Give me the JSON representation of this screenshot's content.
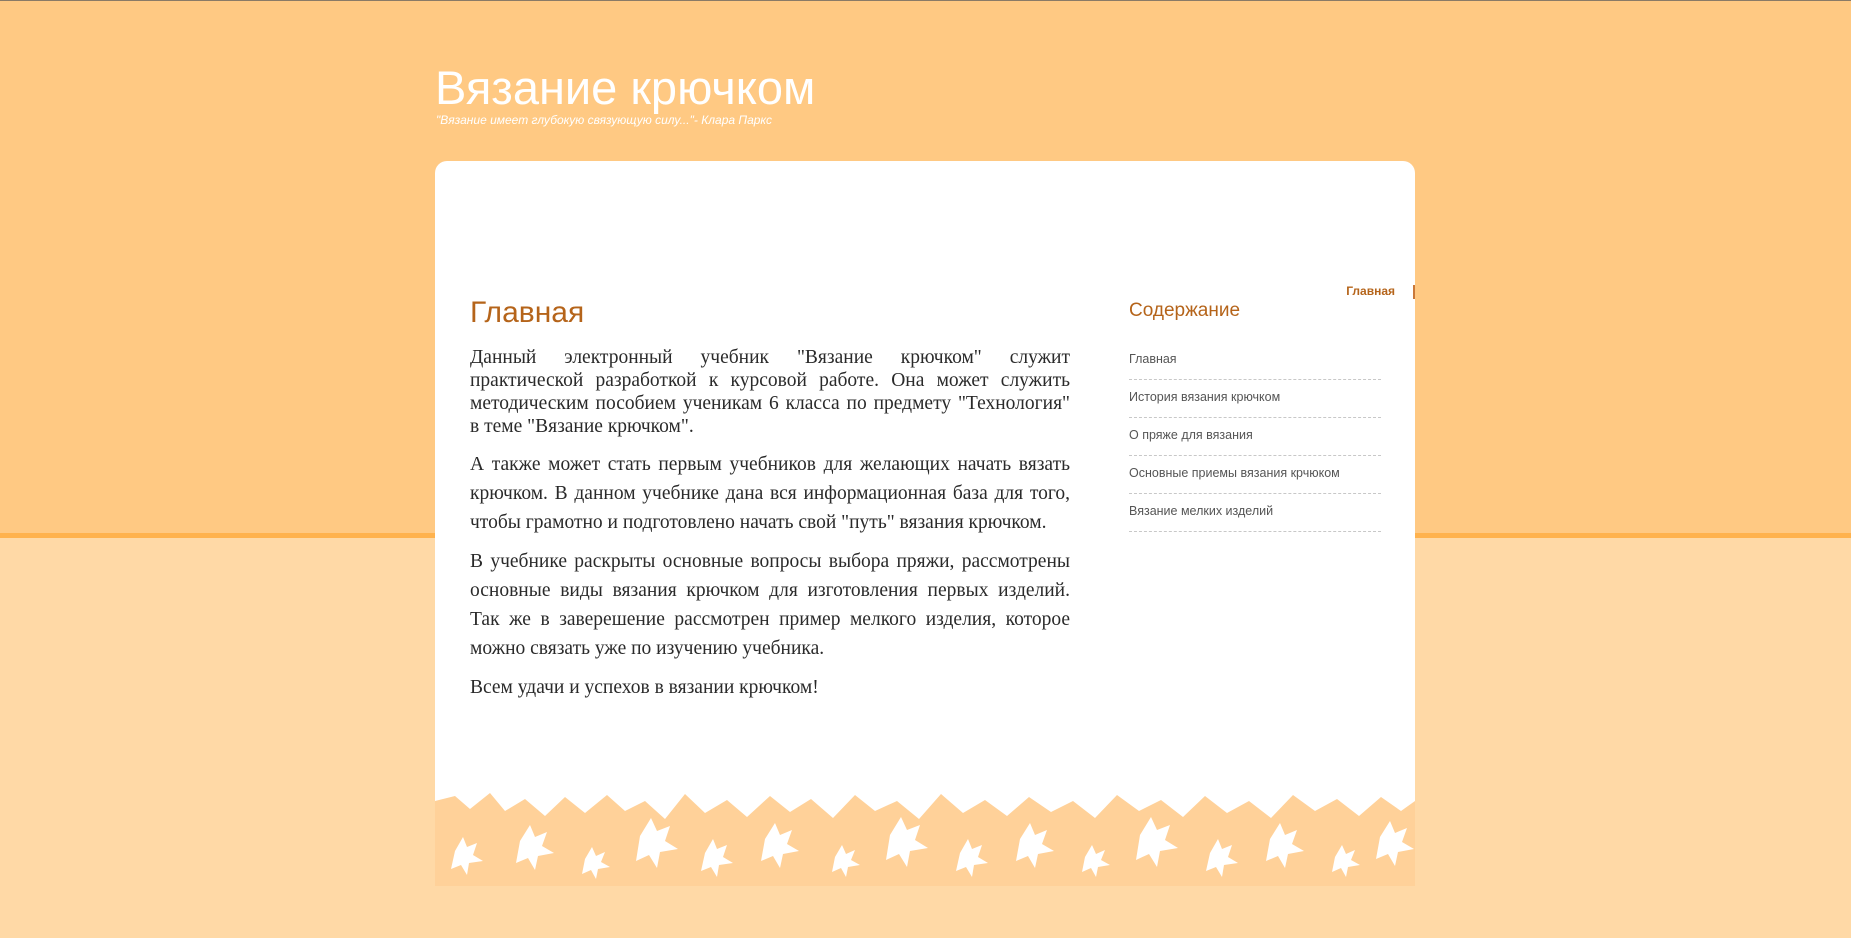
{
  "header": {
    "title": "Вязание крючком",
    "tagline": "\"Вязание имеет глубокую связующую силу...\"- Клара Паркс"
  },
  "top_nav": {
    "active_label": "Главная"
  },
  "main": {
    "title": "Главная",
    "paragraphs": [
      "Данный электронный учебник \"Вязание крючком\" служит практической разработкой к курсовой работе. Она может служить методическим пособием ученикам 6 класса по предмету \"Технология\" в теме \"Вязание крючком\".",
      "А также может стать первым учебников для желающих начать вязать крючком. В данном учебнике дана вся информационная база для того, чтобы грамотно и подготовлено начать свой \"путь\" вязания крючком.",
      "В учебнике раскрыты основные вопросы выбора пряжи, рассмотрены основные виды вязания крючком для изготовления первых изделий. Так  же в заверешение рассмотрен пример мелкого изделия, которое можно связать уже по изучению учебника.",
      "Всем удачи и успехов в вязании крючком!"
    ]
  },
  "sidebar": {
    "title": "Содержание",
    "items": [
      {
        "label": "Главная"
      },
      {
        "label": "История вязания крючком"
      },
      {
        "label": "О пряже для вязания"
      },
      {
        "label": "Основные приемы вязания крчюком"
      },
      {
        "label": "Вязание мелких изделий"
      }
    ]
  },
  "colors": {
    "page_background_top": "#ffc983",
    "page_background_bottom": "#ffd9a6",
    "accent": "#b5641a",
    "card": "#ffffff"
  }
}
